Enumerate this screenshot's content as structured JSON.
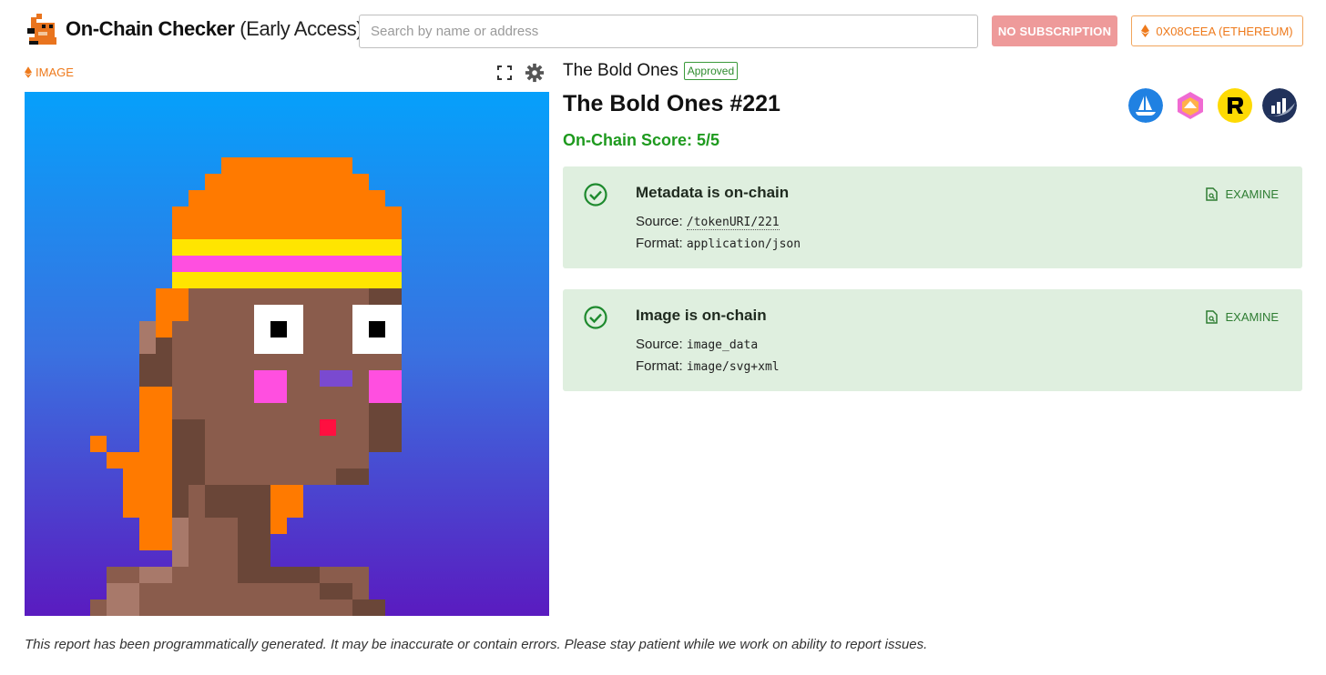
{
  "header": {
    "brand_bold": "On-Chain Checker",
    "brand_light": "(Early Access)",
    "search_placeholder": "Search by name or address",
    "subscription_label": "NO SUBSCRIPTION",
    "wallet_label": "0X08CEEA (ETHEREUM)",
    "accent_color": "#ee7a1c"
  },
  "image_panel": {
    "label": "IMAGE",
    "icons": [
      "ethereum-icon",
      "expand-icon",
      "gear-icon"
    ]
  },
  "token": {
    "collection": "The Bold Ones",
    "status_badge": "Approved",
    "title": "The Bold Ones #221",
    "score": "On-Chain Score: 5/5",
    "marketplaces": [
      "opensea-icon",
      "looksrare-icon",
      "rarible-icon",
      "etherscan-icon"
    ]
  },
  "checks": [
    {
      "title": "Metadata is on-chain",
      "source_label": "Source:",
      "source_value": "/tokenURI/221",
      "format_label": "Format:",
      "format_value": "application/json",
      "action": "EXAMINE"
    },
    {
      "title": "Image is on-chain",
      "source_label": "Source:",
      "source_value": "image_data",
      "format_label": "Format:",
      "format_value": "image/svg+xml",
      "action": "EXAMINE"
    }
  ],
  "footer": "This report has been programmatically generated. It may be inaccurate or contain errors. Please stay patient while we work on ability to report issues."
}
